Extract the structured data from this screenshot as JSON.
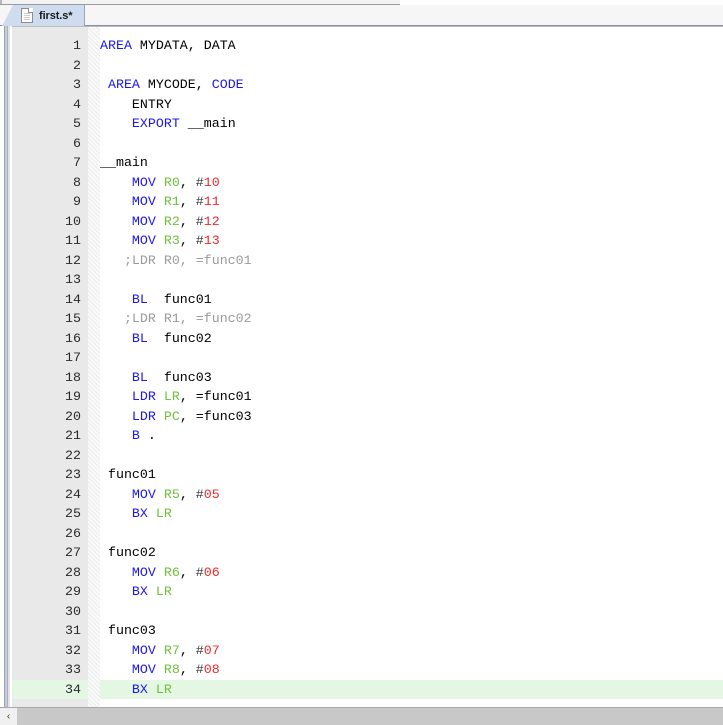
{
  "window": {
    "tab": {
      "label": "first.s*",
      "icon": "document-icon",
      "modified": true
    }
  },
  "editor": {
    "active_line": 34,
    "active_line_highlight_color": "#e3f7e3",
    "gutter_bg": "#e9e9e9",
    "colors": {
      "keyword": "#1c17f0",
      "register": "#6fc03c",
      "number": "#f0282d",
      "comment": "#9b9b9b",
      "text": "#000000",
      "background": "#ffffff"
    },
    "lines": [
      {
        "n": "1",
        "tokens": [
          {
            "t": "AREA",
            "c": "kw"
          },
          {
            "t": " MYDATA, DATA",
            "c": "plain"
          }
        ]
      },
      {
        "n": "2",
        "tokens": []
      },
      {
        "n": "3",
        "tokens": [
          {
            "t": " ",
            "c": "plain"
          },
          {
            "t": "AREA",
            "c": "kw"
          },
          {
            "t": " MYCODE, ",
            "c": "plain"
          },
          {
            "t": "CODE",
            "c": "kw"
          }
        ]
      },
      {
        "n": "4",
        "tokens": [
          {
            "t": "    ENTRY",
            "c": "plain"
          }
        ]
      },
      {
        "n": "5",
        "tokens": [
          {
            "t": "    ",
            "c": "plain"
          },
          {
            "t": "EXPORT",
            "c": "kw"
          },
          {
            "t": " __main",
            "c": "plain"
          }
        ]
      },
      {
        "n": "6",
        "tokens": []
      },
      {
        "n": "7",
        "tokens": [
          {
            "t": "__main",
            "c": "plain"
          }
        ]
      },
      {
        "n": "8",
        "tokens": [
          {
            "t": "    ",
            "c": "plain"
          },
          {
            "t": "MOV",
            "c": "kw"
          },
          {
            "t": " ",
            "c": "plain"
          },
          {
            "t": "R0",
            "c": "reg"
          },
          {
            "t": ", ",
            "c": "plain"
          },
          {
            "t": "#",
            "c": "hash"
          },
          {
            "t": "10",
            "c": "num"
          }
        ]
      },
      {
        "n": "9",
        "tokens": [
          {
            "t": "    ",
            "c": "plain"
          },
          {
            "t": "MOV",
            "c": "kw"
          },
          {
            "t": " ",
            "c": "plain"
          },
          {
            "t": "R1",
            "c": "reg"
          },
          {
            "t": ", ",
            "c": "plain"
          },
          {
            "t": "#",
            "c": "hash"
          },
          {
            "t": "11",
            "c": "num"
          }
        ]
      },
      {
        "n": "10",
        "tokens": [
          {
            "t": "    ",
            "c": "plain"
          },
          {
            "t": "MOV",
            "c": "kw"
          },
          {
            "t": " ",
            "c": "plain"
          },
          {
            "t": "R2",
            "c": "reg"
          },
          {
            "t": ", ",
            "c": "plain"
          },
          {
            "t": "#",
            "c": "hash"
          },
          {
            "t": "12",
            "c": "num"
          }
        ]
      },
      {
        "n": "11",
        "tokens": [
          {
            "t": "    ",
            "c": "plain"
          },
          {
            "t": "MOV",
            "c": "kw"
          },
          {
            "t": " ",
            "c": "plain"
          },
          {
            "t": "R3",
            "c": "reg"
          },
          {
            "t": ", ",
            "c": "plain"
          },
          {
            "t": "#",
            "c": "hash"
          },
          {
            "t": "13",
            "c": "num"
          }
        ]
      },
      {
        "n": "12",
        "tokens": [
          {
            "t": "   ;LDR R0, =func01",
            "c": "cmt"
          }
        ]
      },
      {
        "n": "13",
        "tokens": []
      },
      {
        "n": "14",
        "tokens": [
          {
            "t": "    ",
            "c": "plain"
          },
          {
            "t": "BL",
            "c": "kw"
          },
          {
            "t": "  func01",
            "c": "plain"
          }
        ]
      },
      {
        "n": "15",
        "tokens": [
          {
            "t": "   ;LDR R1, =func02",
            "c": "cmt"
          }
        ]
      },
      {
        "n": "16",
        "tokens": [
          {
            "t": "    ",
            "c": "plain"
          },
          {
            "t": "BL",
            "c": "kw"
          },
          {
            "t": "  func02",
            "c": "plain"
          }
        ]
      },
      {
        "n": "17",
        "tokens": []
      },
      {
        "n": "18",
        "tokens": [
          {
            "t": "    ",
            "c": "plain"
          },
          {
            "t": "BL",
            "c": "kw"
          },
          {
            "t": "  func03",
            "c": "plain"
          }
        ]
      },
      {
        "n": "19",
        "tokens": [
          {
            "t": "    ",
            "c": "plain"
          },
          {
            "t": "LDR",
            "c": "kw"
          },
          {
            "t": " ",
            "c": "plain"
          },
          {
            "t": "LR",
            "c": "reg"
          },
          {
            "t": ", =func01",
            "c": "plain"
          }
        ]
      },
      {
        "n": "20",
        "tokens": [
          {
            "t": "    ",
            "c": "plain"
          },
          {
            "t": "LDR",
            "c": "kw"
          },
          {
            "t": " ",
            "c": "plain"
          },
          {
            "t": "PC",
            "c": "reg"
          },
          {
            "t": ", =func03",
            "c": "plain"
          }
        ]
      },
      {
        "n": "21",
        "tokens": [
          {
            "t": "    ",
            "c": "plain"
          },
          {
            "t": "B",
            "c": "kw"
          },
          {
            "t": " .",
            "c": "plain"
          }
        ]
      },
      {
        "n": "22",
        "tokens": []
      },
      {
        "n": "23",
        "tokens": [
          {
            "t": " func01",
            "c": "plain"
          }
        ]
      },
      {
        "n": "24",
        "tokens": [
          {
            "t": "    ",
            "c": "plain"
          },
          {
            "t": "MOV",
            "c": "kw"
          },
          {
            "t": " ",
            "c": "plain"
          },
          {
            "t": "R5",
            "c": "reg"
          },
          {
            "t": ", ",
            "c": "plain"
          },
          {
            "t": "#",
            "c": "hash"
          },
          {
            "t": "05",
            "c": "num"
          }
        ]
      },
      {
        "n": "25",
        "tokens": [
          {
            "t": "    ",
            "c": "plain"
          },
          {
            "t": "BX",
            "c": "kw"
          },
          {
            "t": " ",
            "c": "plain"
          },
          {
            "t": "LR",
            "c": "reg"
          }
        ]
      },
      {
        "n": "26",
        "tokens": []
      },
      {
        "n": "27",
        "tokens": [
          {
            "t": " func02",
            "c": "plain"
          }
        ]
      },
      {
        "n": "28",
        "tokens": [
          {
            "t": "    ",
            "c": "plain"
          },
          {
            "t": "MOV",
            "c": "kw"
          },
          {
            "t": " ",
            "c": "plain"
          },
          {
            "t": "R6",
            "c": "reg"
          },
          {
            "t": ", ",
            "c": "plain"
          },
          {
            "t": "#",
            "c": "hash"
          },
          {
            "t": "06",
            "c": "num"
          }
        ]
      },
      {
        "n": "29",
        "tokens": [
          {
            "t": "    ",
            "c": "plain"
          },
          {
            "t": "BX",
            "c": "kw"
          },
          {
            "t": " ",
            "c": "plain"
          },
          {
            "t": "LR",
            "c": "reg"
          }
        ]
      },
      {
        "n": "30",
        "tokens": []
      },
      {
        "n": "31",
        "tokens": [
          {
            "t": " func03",
            "c": "plain"
          }
        ]
      },
      {
        "n": "32",
        "tokens": [
          {
            "t": "    ",
            "c": "plain"
          },
          {
            "t": "MOV",
            "c": "kw"
          },
          {
            "t": " ",
            "c": "plain"
          },
          {
            "t": "R7",
            "c": "reg"
          },
          {
            "t": ", ",
            "c": "plain"
          },
          {
            "t": "#",
            "c": "hash"
          },
          {
            "t": "07",
            "c": "num"
          }
        ]
      },
      {
        "n": "33",
        "tokens": [
          {
            "t": "    ",
            "c": "plain"
          },
          {
            "t": "MOV",
            "c": "kw"
          },
          {
            "t": " ",
            "c": "plain"
          },
          {
            "t": "R8",
            "c": "reg"
          },
          {
            "t": ", ",
            "c": "plain"
          },
          {
            "t": "#",
            "c": "hash"
          },
          {
            "t": "08",
            "c": "num"
          }
        ]
      },
      {
        "n": "34",
        "tokens": [
          {
            "t": "    ",
            "c": "plain"
          },
          {
            "t": "BX",
            "c": "kw"
          },
          {
            "t": " ",
            "c": "plain"
          },
          {
            "t": "LR",
            "c": "reg"
          }
        ],
        "highlight": true
      }
    ]
  },
  "scrollbars": {
    "horizontal": {
      "left_arrow": "‹"
    }
  }
}
